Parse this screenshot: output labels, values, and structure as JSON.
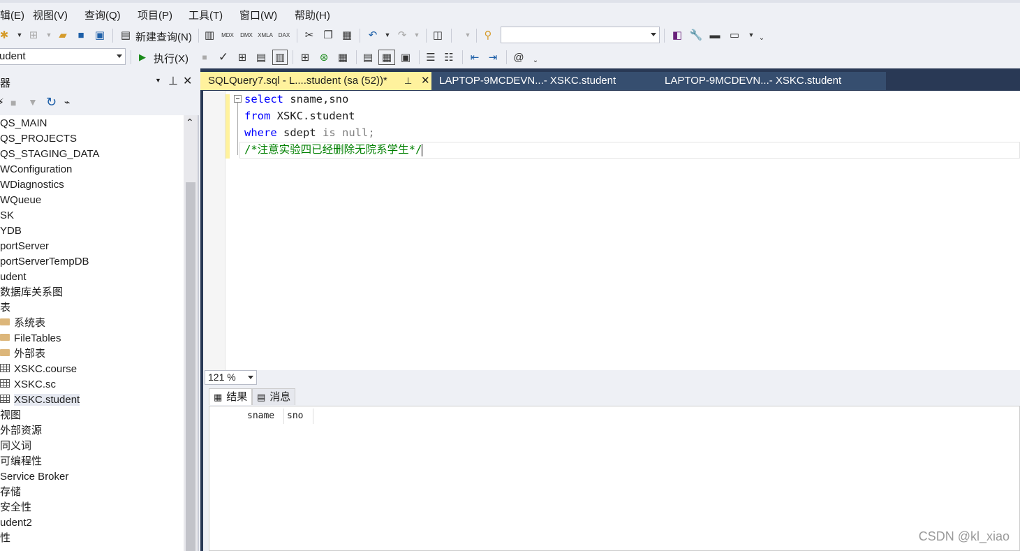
{
  "menubar": {
    "items": [
      "辑(E)",
      "视图(V)",
      "查询(Q)",
      "项目(P)",
      "工具(T)",
      "窗口(W)",
      "帮助(H)"
    ]
  },
  "toolbar1": {
    "new_query_label": "新建查询(N)",
    "icons": [
      "new-project-icon",
      "add-item-icon",
      "open-icon",
      "save-icon",
      "save-all-icon",
      "new-query-icon",
      "mdx-icon",
      "dmx-icon",
      "xmla-icon",
      "dax-icon",
      "cut-icon",
      "copy-icon",
      "paste-icon",
      "undo-icon",
      "redo-icon",
      "activity-monitor-icon",
      "find-icon",
      "solution-explorer-icon",
      "properties-icon",
      "toolbox-icon",
      "command-window-icon"
    ],
    "icon_labels": {
      "mdx": "MDX",
      "dmx": "DMX",
      "xmla": "XMLA",
      "dax": "DAX"
    },
    "search_combo_value": ""
  },
  "toolbar2": {
    "database_combo_value": "udent",
    "execute_label": "执行(X)"
  },
  "object_explorer": {
    "title": "器",
    "tree": [
      {
        "label": "QS_MAIN",
        "icon": "none"
      },
      {
        "label": "QS_PROJECTS",
        "icon": "none"
      },
      {
        "label": "QS_STAGING_DATA",
        "icon": "none"
      },
      {
        "label": "WConfiguration",
        "icon": "none"
      },
      {
        "label": "WDiagnostics",
        "icon": "none"
      },
      {
        "label": "WQueue",
        "icon": "none"
      },
      {
        "label": "SK",
        "icon": "none"
      },
      {
        "label": "YDB",
        "icon": "none"
      },
      {
        "label": "portServer",
        "icon": "none"
      },
      {
        "label": "portServerTempDB",
        "icon": "none"
      },
      {
        "label": "udent",
        "icon": "none"
      },
      {
        "label": "数据库关系图",
        "icon": "none"
      },
      {
        "label": "表",
        "icon": "none"
      },
      {
        "label": "系统表",
        "icon": "folder"
      },
      {
        "label": "FileTables",
        "icon": "folder"
      },
      {
        "label": "外部表",
        "icon": "folder"
      },
      {
        "label": "XSKC.course",
        "icon": "table"
      },
      {
        "label": "XSKC.sc",
        "icon": "table"
      },
      {
        "label": "XSKC.student",
        "icon": "table",
        "selected": true
      },
      {
        "label": "视图",
        "icon": "none"
      },
      {
        "label": "外部资源",
        "icon": "none"
      },
      {
        "label": "同义词",
        "icon": "none"
      },
      {
        "label": "可编程性",
        "icon": "none"
      },
      {
        "label": "Service Broker",
        "icon": "none"
      },
      {
        "label": "存储",
        "icon": "none"
      },
      {
        "label": "安全性",
        "icon": "none"
      },
      {
        "label": "udent2",
        "icon": "none"
      },
      {
        "label": "性",
        "icon": "none"
      }
    ]
  },
  "tabs": [
    {
      "label": "SQLQuery7.sql - L....student (sa (52))*",
      "active": true
    },
    {
      "label": "LAPTOP-9MCDEVN...- XSKC.student",
      "active": false
    },
    {
      "label": "LAPTOP-9MCDEVN...- XSKC.student",
      "active": false
    }
  ],
  "editor": {
    "line1_kw": "select",
    "line1_rest": " sname,sno",
    "line2_kw": "from",
    "line2_rest": " XSKC.student",
    "line3_kw": "where",
    "line3_mid": " sdept ",
    "line3_gray": "is null;",
    "line4_comment": "/*注意实验四已经删除无院系学生*/"
  },
  "zoom": {
    "value": "121 %"
  },
  "results": {
    "tab_results": "结果",
    "tab_messages": "消息",
    "columns": [
      "sname",
      "sno"
    ]
  },
  "watermark": "CSDN @kl_xiao"
}
